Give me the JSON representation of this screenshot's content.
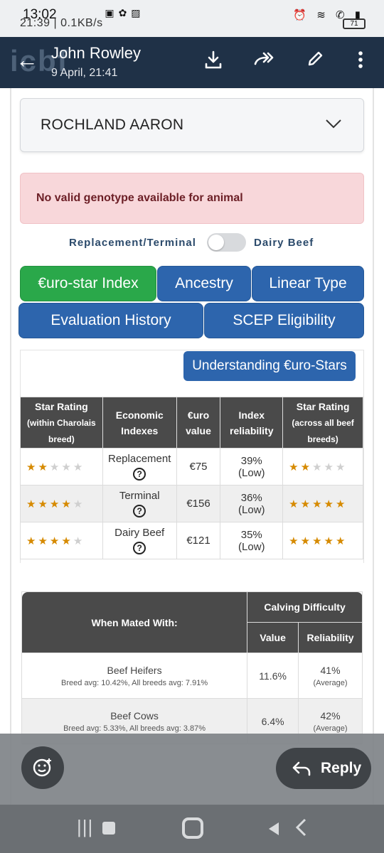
{
  "status": {
    "time": "13:02",
    "inner_status": "21:39 | 0.1KB/s",
    "battery": "71"
  },
  "header": {
    "logo": "icbf",
    "name": "John Rowley",
    "date": "9 April, 21:41"
  },
  "animal_select": {
    "value": "ROCHLAND AARON"
  },
  "alert": {
    "text": "No valid genotype available for animal"
  },
  "toggle": {
    "left_label": "Replacement/Terminal",
    "right_label": "Dairy Beef"
  },
  "tabs": {
    "euro_star": "€uro-star Index",
    "ancestry": "Ancestry",
    "linear_type": "Linear Type",
    "eval_history": "Evaluation History",
    "scep": "SCEP Eligibility"
  },
  "understand_button": "Understanding €uro-Stars",
  "index_table": {
    "headers": {
      "star_within": "Star Rating",
      "star_within_sub": "(within Charolais breed)",
      "economic": "Economic Indexes",
      "euro_value": "€uro value",
      "reliability": "Index reliability",
      "star_across": "Star Rating",
      "star_across_sub": "(across all beef breeds)"
    },
    "rows": [
      {
        "index": "Replacement",
        "value": "€75",
        "reliability": "39%",
        "rel_level": "(Low)",
        "stars_within": 2,
        "stars_across": 2
      },
      {
        "index": "Terminal",
        "value": "€156",
        "reliability": "36%",
        "rel_level": "(Low)",
        "stars_within": 4,
        "stars_across": 5
      },
      {
        "index": "Dairy Beef",
        "value": "€121",
        "reliability": "35%",
        "rel_level": "(Low)",
        "stars_within": 4,
        "stars_across": 5
      }
    ]
  },
  "calving_table": {
    "mated_with": "When Mated With:",
    "group": "Calving Difficulty",
    "value_col": "Value",
    "rel_col": "Reliability",
    "rows": [
      {
        "name": "Beef Heifers",
        "avg": "Breed avg: 10.42%, All breeds avg: 7.91%",
        "value": "11.6%",
        "reliability": "41%",
        "rel_level": "(Average)"
      },
      {
        "name": "Beef Cows",
        "avg": "Breed avg: 5.33%, All breeds avg: 3.87%",
        "value": "6.4%",
        "reliability": "42%",
        "rel_level": "(Average)"
      }
    ]
  },
  "reply_button": "Reply",
  "colors": {
    "header": "#1f3147",
    "tab_blue": "#2d65ad",
    "tab_green": "#2aa84a",
    "star": "#d68a00"
  }
}
